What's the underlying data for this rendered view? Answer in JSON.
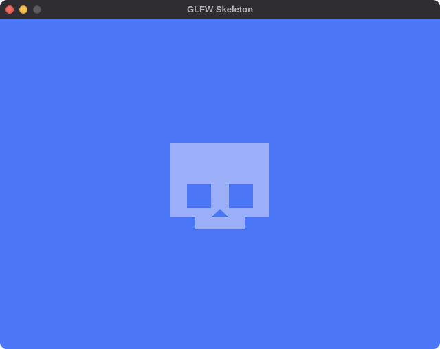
{
  "window": {
    "title": "GLFW Skeleton",
    "buttons": [
      "close",
      "minimize",
      "zoom"
    ]
  },
  "content": {
    "background_color": "#4b76f5",
    "graphic": "skull-icon",
    "graphic_color": "#9aaff7"
  }
}
